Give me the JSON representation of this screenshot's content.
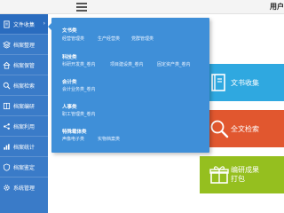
{
  "header": {
    "menu_icon": "hamburger-icon",
    "user_label": "用户"
  },
  "sidebar": {
    "items": [
      {
        "label": "文件收集",
        "icon": "document-icon",
        "active": true
      },
      {
        "label": "档案整理",
        "icon": "layers-icon"
      },
      {
        "label": "档案保管",
        "icon": "house-icon"
      },
      {
        "label": "档案检索",
        "icon": "search-icon"
      },
      {
        "label": "档案编研",
        "icon": "book-icon"
      },
      {
        "label": "档案利用",
        "icon": "share-icon"
      },
      {
        "label": "档案统计",
        "icon": "chart-icon"
      },
      {
        "label": "档案鉴定",
        "icon": "shield-icon"
      },
      {
        "label": "系统管理",
        "icon": "gear-icon"
      }
    ],
    "active_chevron": "›"
  },
  "dropdown": {
    "groups": [
      {
        "title": "文书类",
        "links": [
          "经营管理类",
          "生产经营类",
          "党群管理类"
        ]
      },
      {
        "title": "科技类",
        "links": [
          "科研开发类_卷内",
          "项目建设类_卷内",
          "固定资产类_卷内"
        ]
      },
      {
        "title": "会计类",
        "links": [
          "会计业务类_卷内"
        ]
      },
      {
        "title": "人事类",
        "links": [
          "职工管理类_卷内"
        ]
      },
      {
        "title": "特殊载体类",
        "links": [
          "声像电子类",
          "实物档案类"
        ]
      }
    ]
  },
  "tiles": {
    "a": {
      "line1": "文书收集",
      "line2": "",
      "icon": "book-icon",
      "color": "#2fa8e0"
    },
    "b": {
      "line1": "全文检索",
      "line2": "",
      "icon": "search-icon",
      "color": "#e1572f"
    },
    "c": {
      "line1": "编研成果",
      "line2": "打包",
      "icon": "package-icon",
      "color": "#95bf1f"
    }
  },
  "colors": {
    "sidebar": "#3a7bc8",
    "dropdown": "#3f8fd8"
  }
}
